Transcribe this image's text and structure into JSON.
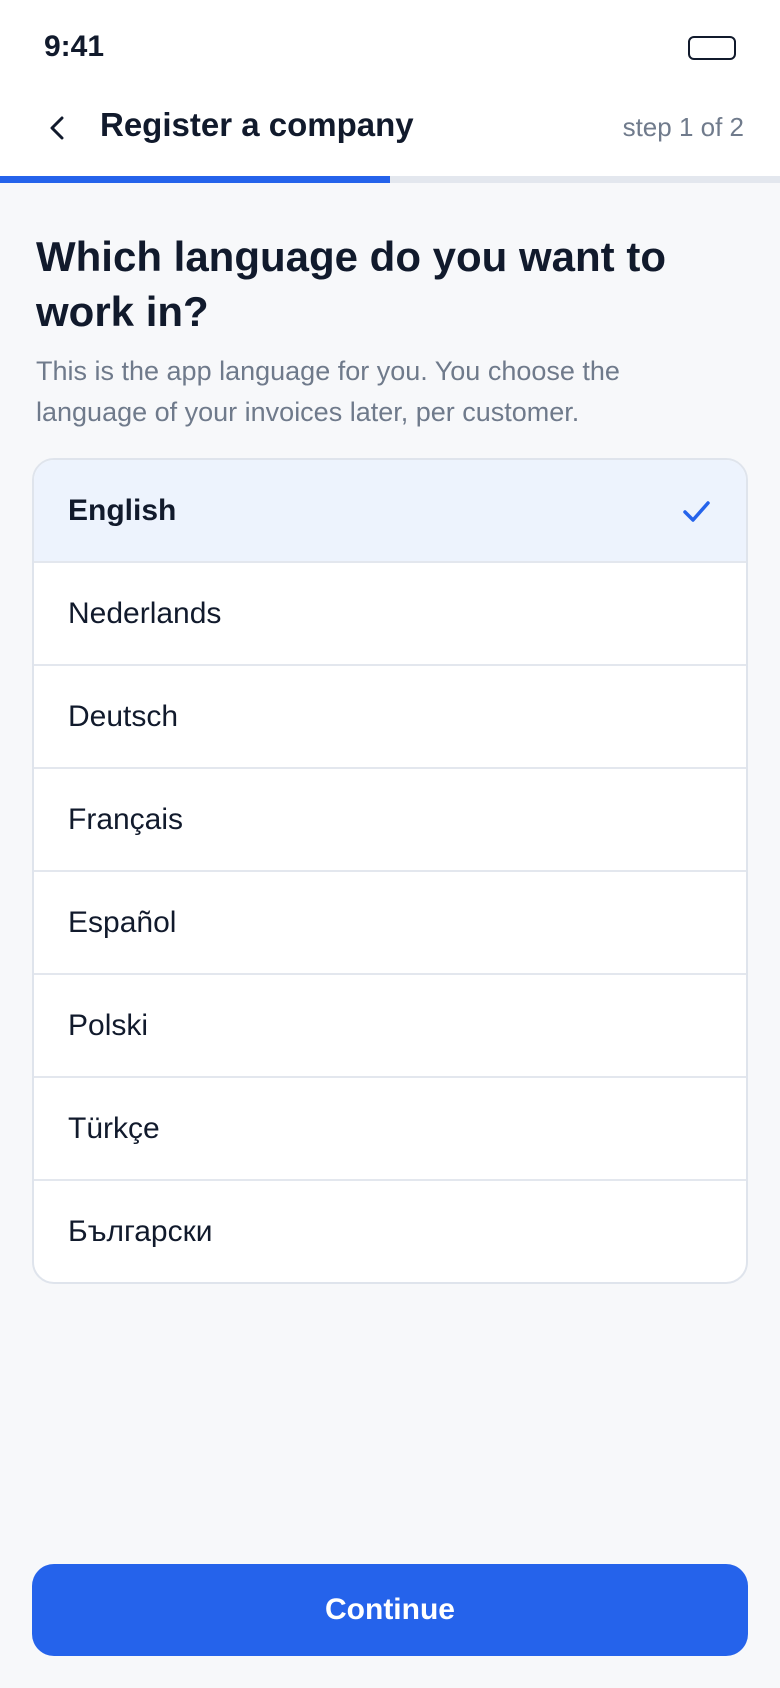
{
  "status_bar": {
    "time": "9:41"
  },
  "header": {
    "title": "Register a company",
    "step": "step 1 of 2",
    "progress": 0.5
  },
  "main": {
    "question": "Which language do you want to work in?",
    "subtitle": "This is the app language for you. You choose the language of your invoices later, per customer."
  },
  "languages": [
    {
      "label": "English",
      "selected": true
    },
    {
      "label": "Nederlands",
      "selected": false
    },
    {
      "label": "Deutsch",
      "selected": false
    },
    {
      "label": "Français",
      "selected": false
    },
    {
      "label": "Español",
      "selected": false
    },
    {
      "label": "Polski",
      "selected": false
    },
    {
      "label": "Türkçe",
      "selected": false
    },
    {
      "label": "Български",
      "selected": false
    }
  ],
  "footer": {
    "continue_label": "Continue"
  },
  "colors": {
    "accent": "#2563eb",
    "selected_bg": "#edf3fd"
  },
  "icons": {
    "back": "chevron-left-icon",
    "check": "checkmark-icon",
    "battery": "battery-icon"
  }
}
